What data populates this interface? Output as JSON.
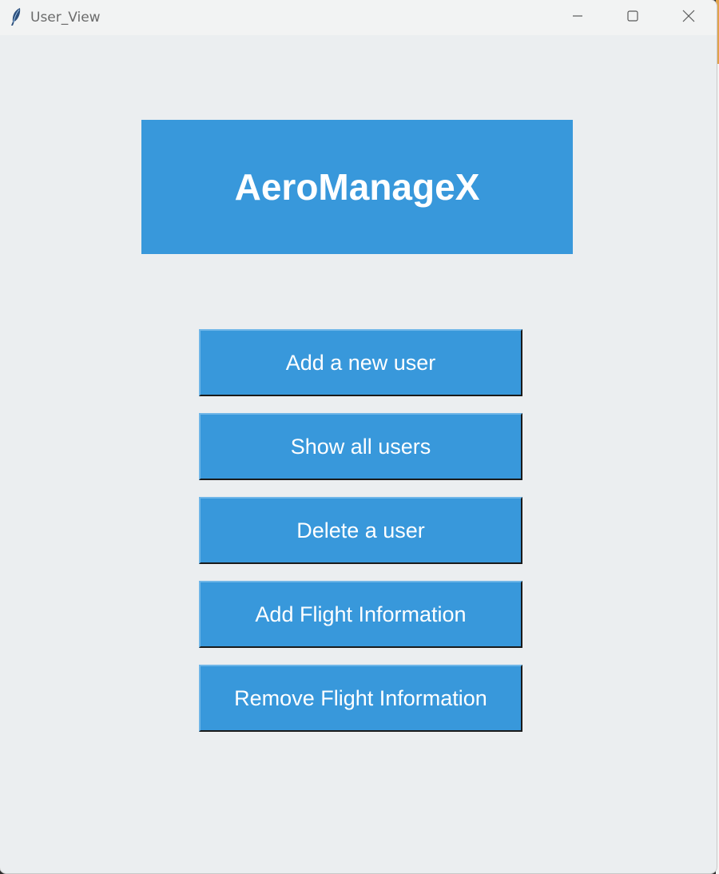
{
  "window": {
    "title": "User_View"
  },
  "header": {
    "app_name": "AeroManageX"
  },
  "menu": {
    "buttons": [
      {
        "label": "Add a new user"
      },
      {
        "label": "Show all users"
      },
      {
        "label": "Delete a user"
      },
      {
        "label": "Add Flight Information"
      },
      {
        "label": "Remove Flight Information"
      }
    ]
  },
  "colors": {
    "accent": "#3898db",
    "background": "#ebeef0",
    "titlebar": "#f2f3f3"
  },
  "icons": {
    "app": "feather-icon",
    "minimize": "minimize-icon",
    "maximize": "maximize-icon",
    "close": "close-icon"
  }
}
